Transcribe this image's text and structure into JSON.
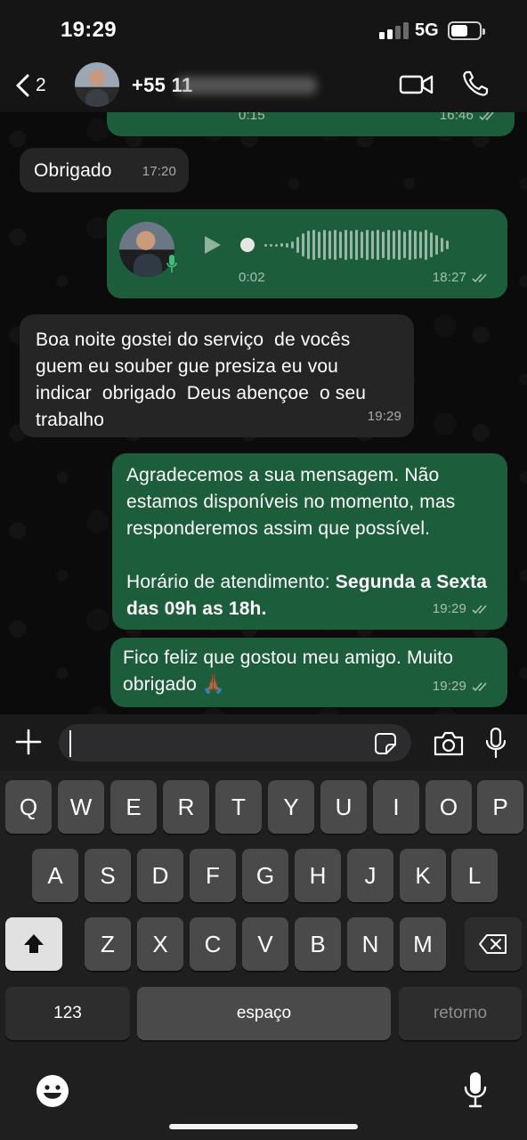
{
  "status_bar": {
    "time": "19:29",
    "network": "5G",
    "battery_level": 0.55
  },
  "header": {
    "back_count": "2",
    "contact_name": "+55 11"
  },
  "messages": [
    {
      "id": "m0",
      "direction": "out",
      "type": "voice",
      "duration": "0:15",
      "time": "16:46",
      "status": "read"
    },
    {
      "id": "m1",
      "direction": "in",
      "text": "Obrigado",
      "time": "17:20"
    },
    {
      "id": "m2",
      "direction": "out",
      "type": "voice",
      "duration": "0:02",
      "time": "18:27",
      "status": "read"
    },
    {
      "id": "m3",
      "direction": "in",
      "text": "Boa noite gostei do serviço  de vocês guem eu souber gue presiza eu vou indicar  obrigado  Deus abençoe  o seu trabalho",
      "time": "19:29"
    },
    {
      "id": "m4",
      "direction": "out",
      "text": "Agradecemos a sua mensagem. Não estamos disponíveis no momento, mas responderemos assim que possível.",
      "text_prefix": "Horário de atendimento: ",
      "text_bold": "Segunda a Sexta das 09h as 18h.",
      "time": "19:29",
      "status": "read"
    },
    {
      "id": "m5",
      "direction": "out",
      "text": "Fico feliz que gostou meu amigo. Muito obrigado 🙏🏾",
      "time": "19:29",
      "status": "read"
    }
  ],
  "input": {
    "value": "",
    "placeholder": ""
  },
  "keyboard": {
    "row1": [
      "Q",
      "W",
      "E",
      "R",
      "T",
      "Y",
      "U",
      "I",
      "O",
      "P"
    ],
    "row2": [
      "A",
      "S",
      "D",
      "F",
      "G",
      "H",
      "J",
      "K",
      "L"
    ],
    "row3": [
      "Z",
      "X",
      "C",
      "V",
      "B",
      "N",
      "M"
    ],
    "numbers_label": "123",
    "space_label": "espaço",
    "return_label": "retorno"
  },
  "icons": {
    "back": "chevron-left-icon",
    "video": "video-camera-icon",
    "call": "phone-icon",
    "plus": "plus-icon",
    "sticker": "sticker-icon",
    "camera": "camera-icon",
    "mic": "microphone-icon",
    "shift": "shift-arrow-icon",
    "delete": "backspace-icon",
    "emoji": "emoji-icon",
    "dictation": "dictation-mic-icon"
  },
  "colors": {
    "outgoing_bubble": "#1c5e3b",
    "incoming_bubble": "#252525",
    "background": "#0b0b0b",
    "key": "#4a4a4a",
    "key_dark": "#2d2d2d"
  }
}
